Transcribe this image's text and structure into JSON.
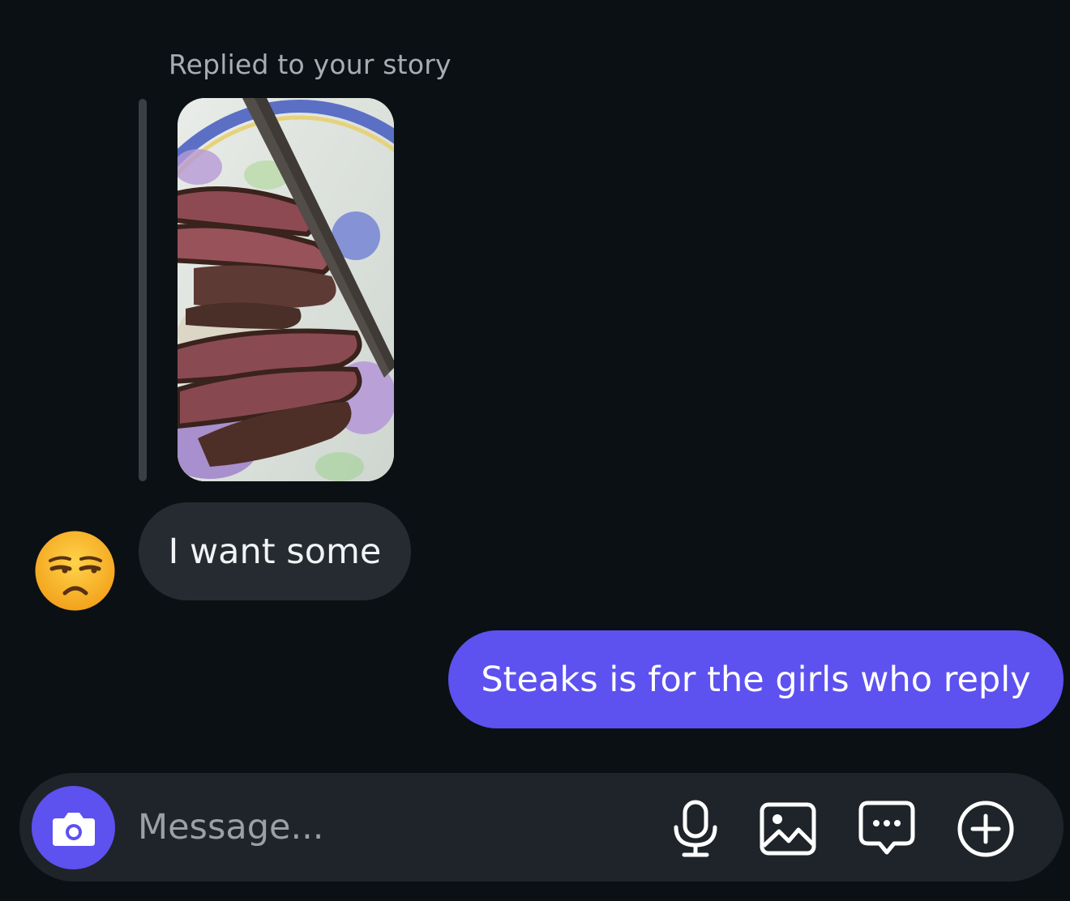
{
  "thread": {
    "story_reply_label": "Replied to your story",
    "incoming_message": "I want some",
    "outgoing_message": "Steaks is for the girls who reply",
    "sender_reaction_emoji": "unamused-face"
  },
  "composer": {
    "placeholder": "Message...",
    "icons": [
      "camera-icon",
      "microphone-icon",
      "gallery-icon",
      "sticker-chat-icon",
      "add-icon"
    ]
  },
  "colors": {
    "background": "#0b1014",
    "outgoing_bubble": "#5d51f0",
    "incoming_bubble": "#262b31",
    "composer": "#1e2429"
  }
}
